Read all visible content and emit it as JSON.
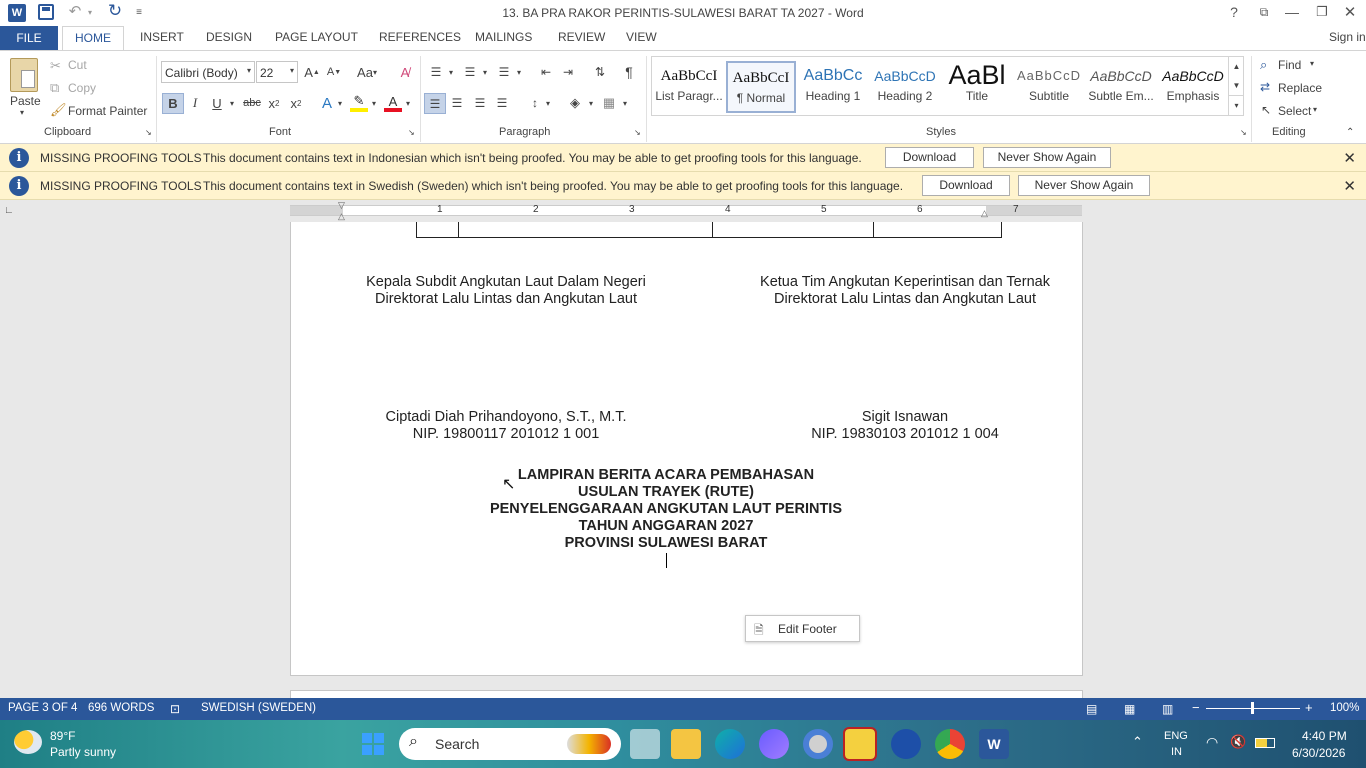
{
  "window": {
    "title": "13. BA PRA RAKOR PERINTIS-SULAWESI BARAT TA 2027 - Word",
    "signin": "Sign in"
  },
  "tabs": [
    "FILE",
    "HOME",
    "INSERT",
    "DESIGN",
    "PAGE LAYOUT",
    "REFERENCES",
    "MAILINGS",
    "REVIEW",
    "VIEW"
  ],
  "ribbon": {
    "clipboard": {
      "paste": "Paste",
      "cut": "Cut",
      "copy": "Copy",
      "format_painter": "Format Painter",
      "group": "Clipboard"
    },
    "font": {
      "name": "Calibri (Body)",
      "size": "22",
      "group": "Font"
    },
    "paragraph": {
      "group": "Paragraph"
    },
    "styles": {
      "items": [
        {
          "preview": "AaBbCcI",
          "name": "List Paragr..."
        },
        {
          "preview": "AaBbCcI",
          "name": "¶ Normal"
        },
        {
          "preview": "AaBbCc",
          "name": "Heading 1"
        },
        {
          "preview": "AaBbCcD",
          "name": "Heading 2"
        },
        {
          "preview": "AaBl",
          "name": "Title"
        },
        {
          "preview": "AaBbCcD",
          "name": "Subtitle"
        },
        {
          "preview": "AaBbCcD",
          "name": "Subtle Em..."
        },
        {
          "preview": "AaBbCcD",
          "name": "Emphasis"
        }
      ],
      "group": "Styles"
    },
    "editing": {
      "find": "Find",
      "replace": "Replace",
      "select": "Select",
      "group": "Editing"
    }
  },
  "messages": [
    {
      "heading": "MISSING PROOFING TOOLS",
      "text": "This document contains text in Indonesian which isn't being proofed. You may be able to get proofing tools for this language.",
      "download": "Download",
      "never": "Never Show Again"
    },
    {
      "heading": "MISSING PROOFING TOOLS",
      "text": "This document contains text in Swedish (Sweden) which isn't being proofed. You may be able to get proofing tools for this language.",
      "download": "Download",
      "never": "Never Show Again"
    }
  ],
  "ruler": {
    "numbers": [
      "1",
      "2",
      "3",
      "4",
      "5",
      "6",
      "7"
    ]
  },
  "document": {
    "left_title_1": "Kepala Subdit Angkutan Laut Dalam Negeri",
    "left_title_2": "Direktorat Lalu Lintas dan Angkutan Laut",
    "right_title_1": "Ketua Tim Angkutan Keperintisan dan Ternak",
    "right_title_2": "Direktorat Lalu Lintas dan Angkutan Laut",
    "left_name": "Ciptadi Diah Prihandoyono, S.T., M.T.",
    "left_nip": "NIP. 19800117 201012 1 001",
    "right_name": "Sigit Isnawan",
    "right_nip": "NIP. 19830103 201012 1 004",
    "heading_lines": [
      "LAMPIRAN BERITA ACARA PEMBAHASAN",
      "USULAN TRAYEK (RUTE)",
      "PENYELENGGARAAN ANGKUTAN LAUT PERINTIS",
      "TAHUN ANGGARAN 2027",
      "PROVINSI SULAWESI BARAT"
    ],
    "edit_footer": "Edit Footer"
  },
  "status": {
    "page": "PAGE 3 OF 4",
    "words": "696 WORDS",
    "language": "SWEDISH (SWEDEN)",
    "zoom": "100%"
  },
  "taskbar": {
    "weather_temp": "89°F",
    "weather_desc": "Partly sunny",
    "search": "Search",
    "lang_1": "ENG",
    "lang_2": "IN",
    "time": "4:40 PM",
    "date": "6/30/2026"
  }
}
